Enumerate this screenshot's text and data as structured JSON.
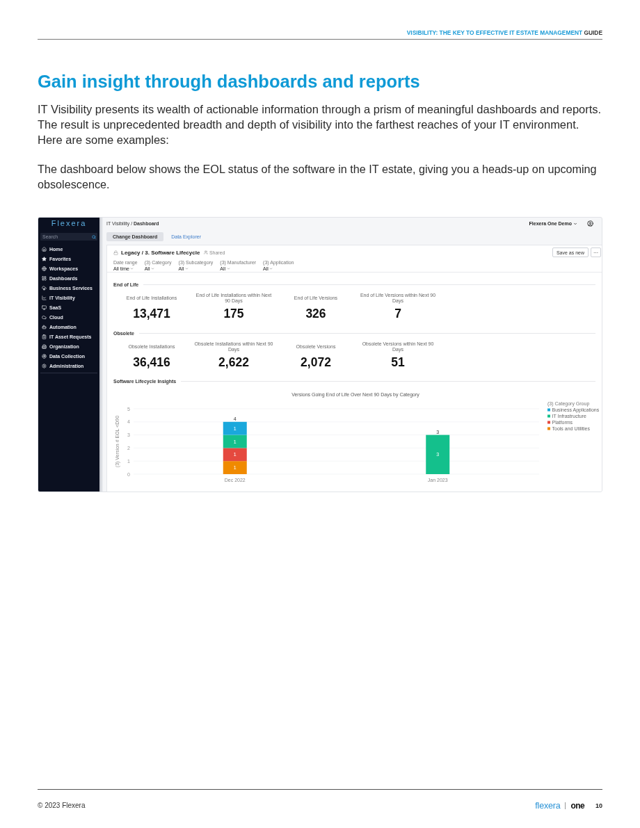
{
  "header": {
    "title": "VISIBILITY: THE KEY TO EFFECTIVE IT ESTATE MANAGEMENT",
    "suffix": "GUIDE"
  },
  "heading": "Gain insight through dashboards and reports",
  "paragraphs": [
    "IT Visibility presents its wealth of actionable information through a prism of meaningful dashboards and reports. The result is unprecedented breadth and depth of visibility into the farthest reaches of your IT environment. Here are some examples:",
    "The dashboard below shows the EOL status of the software in the IT estate, giving you a heads-up on upcoming obsolescence."
  ],
  "dashboard": {
    "sidebar": {
      "logo": "Flexera",
      "search": {
        "placeholder": "Search"
      },
      "items": [
        {
          "label": "Home"
        },
        {
          "label": "Favorites"
        },
        {
          "label": "Workspaces"
        },
        {
          "label": "Dashboards"
        },
        {
          "label": "Business Services"
        },
        {
          "label": "IT Visibility"
        },
        {
          "label": "SaaS"
        },
        {
          "label": "Cloud"
        },
        {
          "label": "Automation"
        },
        {
          "label": "IT Asset Requests"
        },
        {
          "label": "Organization"
        },
        {
          "label": "Data Collection"
        },
        {
          "label": "Administration"
        }
      ]
    },
    "breadcrumb": "IT Visibility / **Dashboard**",
    "account": "Flexera One Demo",
    "tabs": [
      {
        "label": "Change Dashboard",
        "selected": true
      },
      {
        "label": "Data Explorer",
        "selected": false
      }
    ],
    "title": "Legacy / 3. Software Lifecycle",
    "shared": "Shared",
    "buttons": [
      "Save as new",
      "···"
    ],
    "filters": [
      {
        "label": "Date range",
        "value": "All time"
      },
      {
        "label": "(3) Category",
        "value": "All"
      },
      {
        "label": "(3) Subcategory",
        "value": "All"
      },
      {
        "label": "(3) Manufacturer",
        "value": "All"
      },
      {
        "label": "(3) Application",
        "value": "All"
      }
    ],
    "sections": [
      {
        "kind": "kpis",
        "title": "End of Life",
        "kpis": [
          {
            "label": "End of Life Installations",
            "value": "13,471"
          },
          {
            "label": "End of Life Installations within Next 90 Days",
            "value": "175"
          },
          {
            "label": "End of Life Versions",
            "value": "326"
          },
          {
            "label": "End of Life Versions within Next 90 Days",
            "value": "7"
          }
        ]
      },
      {
        "kind": "kpis",
        "title": "Obsolete",
        "kpis": [
          {
            "label": "Obsolete Installations",
            "value": "36,416"
          },
          {
            "label": "Obsolete Installations within Next 90 Days",
            "value": "2,622"
          },
          {
            "label": "Obsolete Versions",
            "value": "2,072"
          },
          {
            "label": "Obsolete Versions within Next 90 Days",
            "value": "51"
          }
        ]
      },
      {
        "kind": "chart",
        "title": "Software Lifecycle Insights",
        "chart_data": {
          "type": "bar",
          "title": "Versions Going End of Life Over Next 90 Days by Category",
          "ylabel": "(3) Version # EOL <D90",
          "categories": [
            "Dec 2022",
            "Jan 2023"
          ],
          "series": [
            {
              "name": "Business Applications",
              "color": "#1aa8dc",
              "values": [
                1,
                null
              ]
            },
            {
              "name": "IT Infrastructure",
              "color": "#14c08c",
              "values": [
                1,
                3
              ]
            },
            {
              "name": "Platforms",
              "color": "#e5493f",
              "values": [
                1,
                null
              ]
            },
            {
              "name": "Tools and Utilities",
              "color": "#f08a00",
              "values": [
                1,
                null
              ]
            }
          ],
          "ylim": [
            0,
            5
          ],
          "yticks": [
            0,
            1,
            2,
            3,
            4,
            5
          ],
          "stacked": true,
          "data_labels": true,
          "grid": true,
          "legend": {
            "title": "(3) Category Group"
          },
          "annotations": [
            "4",
            "3"
          ]
        }
      }
    ]
  },
  "footer": {
    "copyright": "© 2023 Flexera",
    "logo": "flexera",
    "logo_suffix": "one",
    "page": "10"
  }
}
